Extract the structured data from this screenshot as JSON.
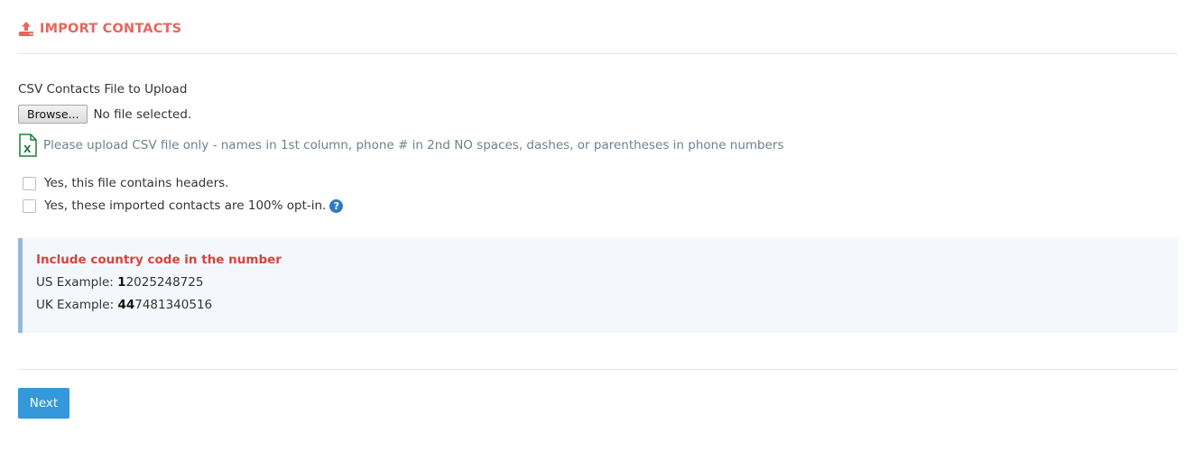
{
  "header": {
    "title": "IMPORT CONTACTS",
    "icon": "upload-icon",
    "color": "#e9645d"
  },
  "upload": {
    "label": "CSV Contacts File to Upload",
    "browse_label": "Browse...",
    "file_status": "No file selected.",
    "hint_icon": "excel-file-icon",
    "hint": "Please upload CSV file only - names in 1st column, phone # in 2nd NO spaces, dashes, or parentheses in phone numbers"
  },
  "options": [
    {
      "label": "Yes, this file contains headers.",
      "checked": false
    },
    {
      "label": "Yes, these imported contacts are 100% opt-in.",
      "checked": false,
      "help_icon": "question-circle-icon",
      "help_glyph": "?"
    }
  ],
  "info": {
    "title": "Include country code in the number",
    "examples": [
      {
        "prefix": "US Example: ",
        "code": "1",
        "number": "2025248725"
      },
      {
        "prefix": "UK Example: ",
        "code": "44",
        "number": "7481340516"
      }
    ],
    "title_color": "#d9433c",
    "border_color": "#97b8dd"
  },
  "actions": {
    "next_label": "Next",
    "next_color": "#3498db"
  }
}
